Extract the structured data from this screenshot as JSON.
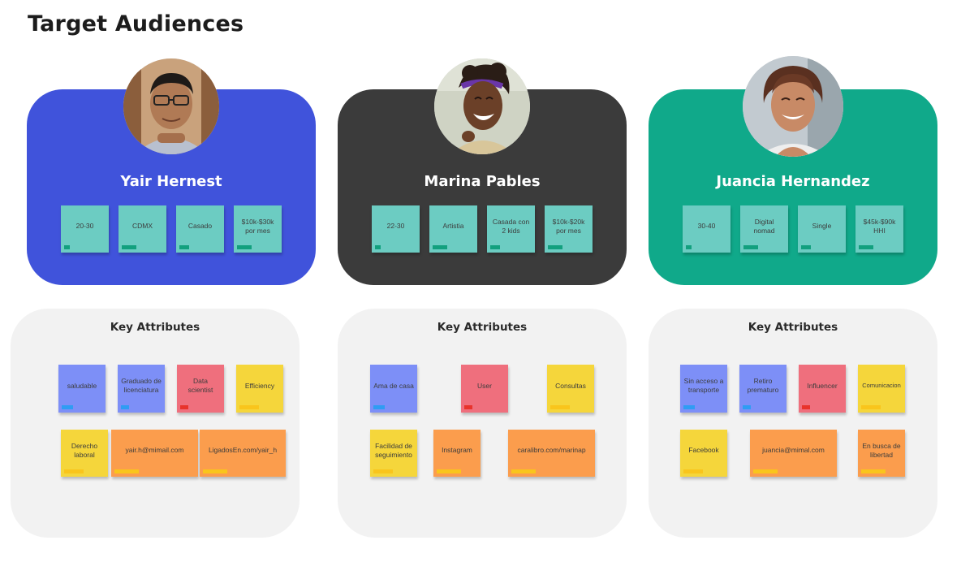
{
  "page": {
    "title": "Target Audiences"
  },
  "colors": {
    "card_blue": "#4053db",
    "card_dark": "#3b3b3b",
    "card_green": "#10a98a",
    "sticky_teal": "#6cccc2",
    "sticky_blue": "#7d8ff7",
    "sticky_red": "#ef6f7d",
    "sticky_yellow": "#f5d63b",
    "sticky_orange": "#fb9d4d",
    "attributes_background": "#f2f2f2"
  },
  "personas": [
    {
      "name": "Yair Hernest",
      "avatar_icon": "man-with-glasses-portrait-icon",
      "tags": [
        "20-30",
        "CDMX",
        "Casado",
        "$10k-$30k por mes"
      ],
      "attributes_title": "Key Attributes",
      "attributes": [
        "saludable",
        "Graduado de licenciatura",
        "Data scientist",
        "Efficiency",
        "Derecho laboral",
        "yair.h@mimail.com",
        "LigadosEn.com/yair_h"
      ]
    },
    {
      "name": "Marina Pables",
      "avatar_icon": "woman-laughing-portrait-icon",
      "tags": [
        "22-30",
        "Artistia",
        "Casada con 2 kids",
        "$10k-$20k por mes"
      ],
      "attributes_title": "Key Attributes",
      "attributes": [
        "Ama de casa",
        "User",
        "Consultas",
        "Facilidad de seguimiento",
        "Instagram",
        "caralibro.com/marinap"
      ]
    },
    {
      "name": "Juancia Hernandez",
      "avatar_icon": "woman-smiling-portrait-icon",
      "tags": [
        "30-40",
        "Digital nomad",
        "Single",
        "$45k-$90k HHI"
      ],
      "attributes_title": "Key Attributes",
      "attributes": [
        "Sin acceso a transporte",
        "Retiro prematuro",
        "Influencer",
        "Comunicacion",
        "Facebook",
        "juancia@mimal.com",
        "En busca de libertad"
      ]
    }
  ]
}
